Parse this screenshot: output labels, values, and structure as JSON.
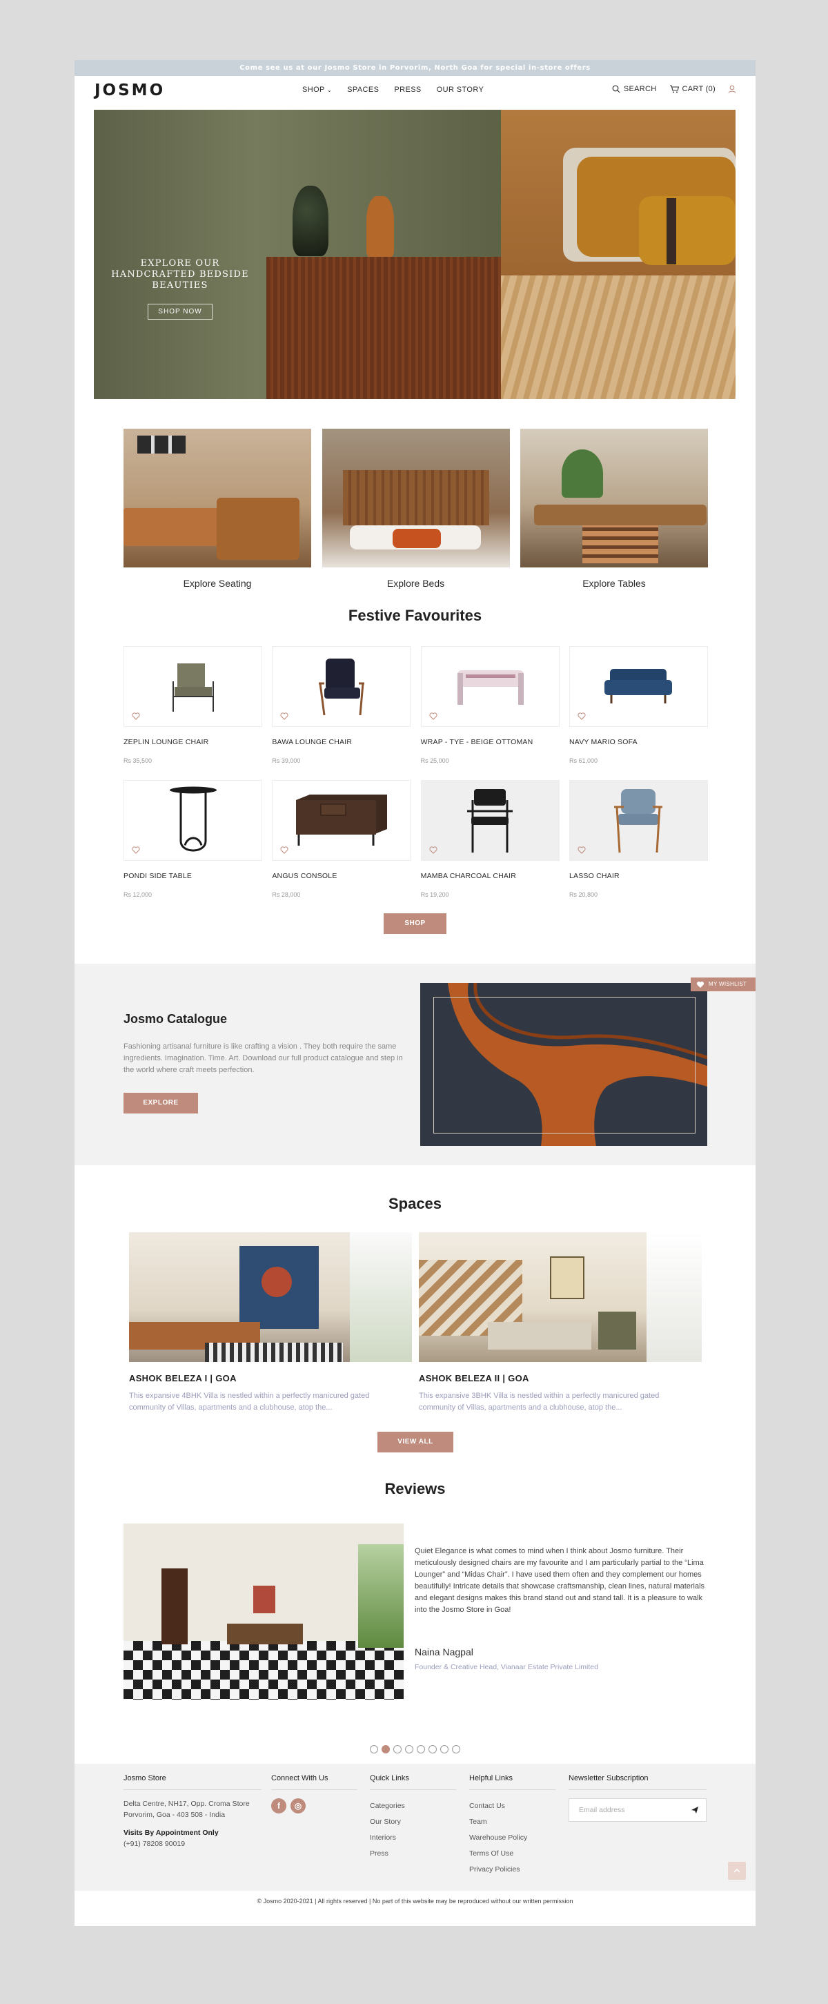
{
  "announcement": "Come see us at our Josmo Store in Porvorim, North Goa for special in-store offers",
  "brand": {
    "logo_text": "JOSMO"
  },
  "nav": {
    "items": [
      "SHOP",
      "SPACES",
      "PRESS",
      "OUR STORY"
    ]
  },
  "header_actions": {
    "search": "SEARCH",
    "cart": "CART (0)"
  },
  "hero": {
    "heading": "EXPLORE OUR HANDCRAFTED BEDSIDE BEAUTIES",
    "button": "SHOP NOW"
  },
  "categories": [
    {
      "label": "Explore Seating"
    },
    {
      "label": "Explore Beds"
    },
    {
      "label": "Explore Tables"
    }
  ],
  "festive": {
    "title": "Festive Favourites",
    "products": [
      {
        "name": "ZEPLIN LOUNGE CHAIR",
        "price": "Rs 35,500"
      },
      {
        "name": "BAWA LOUNGE CHAIR",
        "price": "Rs 39,000"
      },
      {
        "name": "WRAP - TYE - BEIGE OTTOMAN",
        "price": "Rs 25,000"
      },
      {
        "name": "NAVY MARIO SOFA",
        "price": "Rs 61,000"
      },
      {
        "name": "PONDI SIDE TABLE",
        "price": "Rs 12,000"
      },
      {
        "name": "ANGUS CONSOLE",
        "price": "Rs 28,000"
      },
      {
        "name": "MAMBA CHARCOAL CHAIR",
        "price": "Rs 19,200"
      },
      {
        "name": "LASSO CHAIR",
        "price": "Rs 20,800"
      }
    ],
    "shop_button": "SHOP"
  },
  "catalogue": {
    "title": "Josmo Catalogue",
    "text": "Fashioning artisanal furniture is like crafting a vision . They both require the same ingredients. Imagination. Time. Art. Download our full product catalogue and step in the world where craft meets perfection.",
    "button": "EXPLORE",
    "wishlist": "MY WISHLIST"
  },
  "spaces": {
    "title": "Spaces",
    "items": [
      {
        "name": "ASHOK BELEZA I | GOA",
        "desc": "This expansive 4BHK Villa is nestled within a perfectly manicured gated community of Villas, apartments and a clubhouse, atop the..."
      },
      {
        "name": "ASHOK BELEZA II | GOA",
        "desc": "This expansive 3BHK Villa is nestled within a perfectly manicured gated community of Villas, apartments and a clubhouse, atop the..."
      }
    ],
    "view_all": "VIEW ALL"
  },
  "reviews": {
    "title": "Reviews",
    "quote": "Quiet Elegance is what comes to mind when I think about Josmo furniture. Their meticulously designed chairs are my favourite and I am particularly partial to the “Lima Lounger” and “Midas Chair”. I have used them often and they complement our homes beautifully! Intricate details that showcase craftsmanship, clean lines, natural materials and elegant designs makes this brand stand out and stand tall. It is a pleasure to walk into the Josmo Store in Goa!",
    "author": "Naina Nagpal",
    "role": "Founder & Creative Head, Vianaar Estate Private Limited",
    "slide_count": 8,
    "active_slide": 2
  },
  "footer": {
    "store": {
      "title": "Josmo Store",
      "address1": "Delta Centre, NH17, Opp. Croma Store",
      "address2": "Porvorim, Goa - 403 508 - India",
      "visits": "Visits By Appointment Only",
      "phone": "(+91) 78208 90019"
    },
    "connect": {
      "title": "Connect With Us",
      "icons": [
        "f",
        "◎"
      ]
    },
    "quick_links": {
      "title": "Quick Links",
      "items": [
        "Categories",
        "Our Story",
        "Interiors",
        "Press"
      ]
    },
    "helpful_links": {
      "title": "Helpful Links",
      "items": [
        "Contact Us",
        "Team",
        "Warehouse Policy",
        "Terms Of Use",
        "Privacy Policies"
      ]
    },
    "newsletter": {
      "title": "Newsletter Subscription",
      "placeholder": "Email address"
    },
    "copyright": "© Josmo 2020-2021 | All rights reserved | No part of this website may be reproduced without our written permission"
  },
  "colors": {
    "accent": "#bf8b7c",
    "announcement_bg": "#c9d2d8",
    "link_muted": "#9a9dbb"
  }
}
